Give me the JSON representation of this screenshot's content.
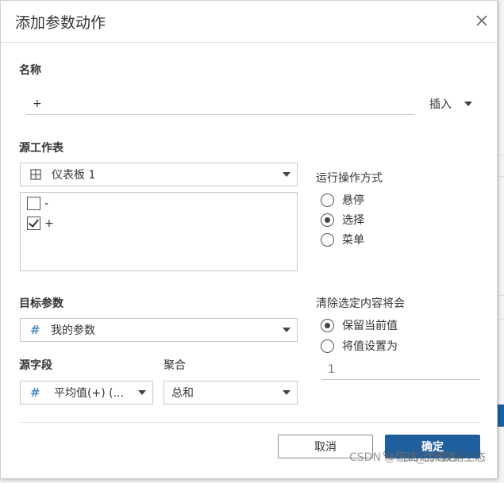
{
  "dialog": {
    "title": "添加参数动作",
    "close_icon": "close-icon"
  },
  "name_section": {
    "label": "名称",
    "value": "+",
    "insert_label": "插入"
  },
  "source_sheet": {
    "label": "源工作表",
    "selected": "仪表板 1",
    "icon": "grid-icon",
    "items": [
      {
        "label": "-",
        "checked": false
      },
      {
        "label": "+",
        "checked": true
      }
    ]
  },
  "run_action": {
    "label": "运行操作方式",
    "options": [
      {
        "label": "悬停",
        "selected": false
      },
      {
        "label": "选择",
        "selected": true
      },
      {
        "label": "菜单",
        "selected": false
      }
    ]
  },
  "target_parameter": {
    "label": "目标参数",
    "selected": "我的参数",
    "icon": "hash-icon"
  },
  "source_field": {
    "label": "源字段",
    "selected": "平均值(+) (...",
    "icon": "hash-icon"
  },
  "aggregation": {
    "label": "聚合",
    "selected": "总和"
  },
  "clear_selection": {
    "label": "清除选定内容将会",
    "options": [
      {
        "label": "保留当前值",
        "selected": true
      },
      {
        "label": "将值设置为",
        "selected": false
      }
    ],
    "value_placeholder": "1"
  },
  "footer": {
    "cancel_label": "取消",
    "ok_label": "确定"
  },
  "watermark": {
    "csdn": "CSDN @阿达_优阅达",
    "brand": "优阅达大数据生态"
  },
  "colors": {
    "primary": "#1f5f9e",
    "hash_icon": "#4a8fc3"
  }
}
